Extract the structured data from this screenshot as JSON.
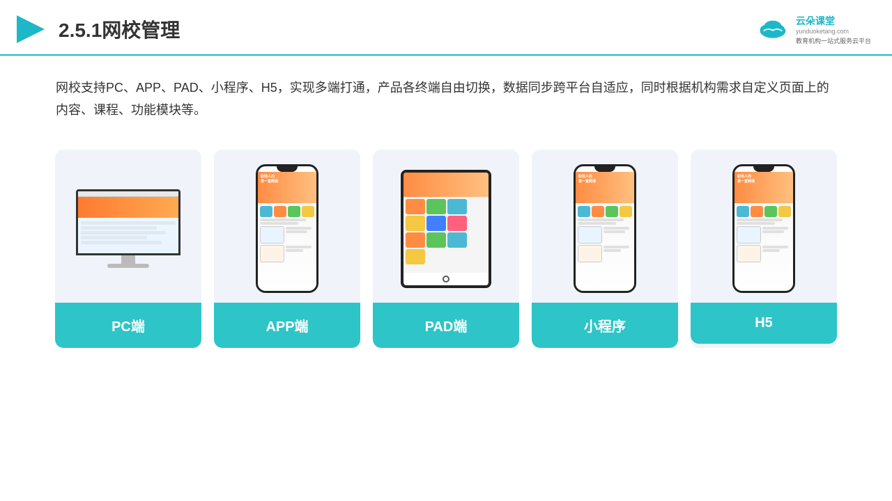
{
  "header": {
    "title": "2.5.1网校管理",
    "logo": {
      "name": "云朵课堂",
      "url": "yunduoketang.com",
      "tagline": "教育机构一站式服务云平台"
    }
  },
  "description": {
    "text": "网校支持PC、APP、PAD、小程序、H5，实现多端打通，产品各终端自由切换，数据同步跨平台自适应，同时根据机构需求自定义页面上的内容、课程、功能模块等。"
  },
  "cards": [
    {
      "id": "pc",
      "label": "PC端"
    },
    {
      "id": "app",
      "label": "APP端"
    },
    {
      "id": "pad",
      "label": "PAD端"
    },
    {
      "id": "miniprogram",
      "label": "小程序"
    },
    {
      "id": "h5",
      "label": "H5"
    }
  ]
}
